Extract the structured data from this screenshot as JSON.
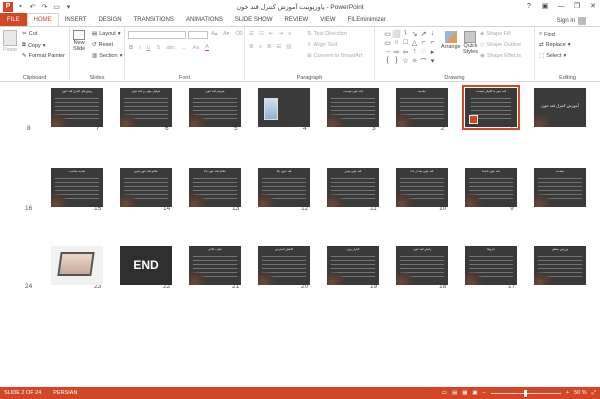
{
  "window": {
    "title": "پاورپوینت آموزش کنترل قند خون - PowerPoint",
    "logo": "P"
  },
  "qat": [
    {
      "icon": "save-icon",
      "glyph": "▪"
    },
    {
      "icon": "undo-icon",
      "glyph": "↶"
    },
    {
      "icon": "redo-icon",
      "glyph": "↷"
    },
    {
      "icon": "present-icon",
      "glyph": "▭"
    },
    {
      "icon": "qat-menu-icon",
      "glyph": "▾"
    }
  ],
  "window_buttons": {
    "help": "?",
    "ribbon_options": "▣",
    "minimize": "—",
    "restore": "❐",
    "close": "✕"
  },
  "tabs": [
    "FILE",
    "HOME",
    "INSERT",
    "DESIGN",
    "TRANSITIONS",
    "ANIMATIONS",
    "SLIDE SHOW",
    "REVIEW",
    "VIEW",
    "FILEminimizer"
  ],
  "active_tab": "HOME",
  "signin": "Sign in",
  "ribbon": {
    "clipboard": {
      "label": "Clipboard",
      "paste": "Paste",
      "cut": "Cut",
      "copy": "Copy",
      "format_painter": "Format Painter"
    },
    "slides": {
      "label": "Slides",
      "new_slide_1": "New",
      "new_slide_2": "Slide",
      "layout": "Layout",
      "reset": "Reset",
      "section": "Section"
    },
    "font": {
      "label": "Font",
      "bold": "B",
      "italic": "I",
      "underline": "U",
      "strike": "S",
      "abc": "abc",
      "aa": "Aa",
      "font_color": "A"
    },
    "paragraph": {
      "label": "Paragraph",
      "text_direction": "Text Direction",
      "align_text": "Align Text",
      "convert_smartart": "Convert to SmartArt"
    },
    "drawing": {
      "label": "Drawing",
      "arrange": "Arrange",
      "quick_styles_1": "Quick",
      "quick_styles_2": "Styles",
      "shape_fill": "Shape Fill",
      "shape_outline": "Shape Outline",
      "shape_effects": "Shape Effects",
      "shapes": [
        "▭",
        "⬜",
        "\\",
        "↘",
        "↗",
        "↓",
        "▭",
        "○",
        "□",
        "△",
        "⌐",
        "⌐",
        "→",
        "⇨",
        "⇦",
        "↑",
        "◌",
        "▸",
        "{",
        "}",
        "☆",
        "✧",
        "⌒",
        "▾"
      ]
    },
    "editing": {
      "label": "Editing",
      "find": "Find",
      "replace": "Replace",
      "select": "Select"
    }
  },
  "slides": [
    {
      "num": "1",
      "title": "آموزش کنترل قند خون",
      "kind": "title"
    },
    {
      "num": "2",
      "title": "قند خون یا گلوکز چیست",
      "kind": "image",
      "selected": true
    },
    {
      "num": "3",
      "title": "مقدمه",
      "kind": "text"
    },
    {
      "num": "4",
      "title": "قند خون چیست",
      "kind": "text"
    },
    {
      "num": "5",
      "title": "",
      "kind": "picture"
    },
    {
      "num": "6",
      "title": "تعریف قند خون",
      "kind": "text"
    },
    {
      "num": "7",
      "title": "عوامل مؤثر بر قند خون",
      "kind": "text"
    },
    {
      "num": "8",
      "title": "روش‌های کنترل قند خون",
      "kind": "text"
    },
    {
      "num": "9",
      "title": "مقدمه",
      "kind": "text"
    },
    {
      "num": "10",
      "title": "قند خون ناشتا",
      "kind": "text"
    },
    {
      "num": "11",
      "title": "قند خون بعد از غذا",
      "kind": "text"
    },
    {
      "num": "12",
      "title": "قند خون پایین",
      "kind": "text"
    },
    {
      "num": "13",
      "title": "قند خون بالا",
      "kind": "text"
    },
    {
      "num": "14",
      "title": "علائم قند خون بالا",
      "kind": "text"
    },
    {
      "num": "15",
      "title": "علائم قند خون پایین",
      "kind": "text"
    },
    {
      "num": "16",
      "title": "تغذیه مناسب",
      "kind": "text"
    },
    {
      "num": "17",
      "title": "ورزش منظم",
      "kind": "text"
    },
    {
      "num": "18",
      "title": "داروها",
      "kind": "text"
    },
    {
      "num": "19",
      "title": "پایش قند خون",
      "kind": "text"
    },
    {
      "num": "20",
      "title": "کنترل وزن",
      "kind": "text"
    },
    {
      "num": "21",
      "title": "کاهش استرس",
      "kind": "text"
    },
    {
      "num": "22",
      "title": "خواب کافی",
      "kind": "text"
    },
    {
      "num": "23",
      "title": "END",
      "kind": "end"
    },
    {
      "num": "24",
      "title": "",
      "kind": "laptop"
    }
  ],
  "status": {
    "slide_info": "SLIDE 2 OF 24",
    "language": "PERSIAN",
    "zoom": "50 %",
    "zoom_out": "−",
    "zoom_in": "+",
    "zoom_level": 0.5
  },
  "colors": {
    "accent": "#d24726",
    "slide_bg": "#3a3a3a"
  }
}
